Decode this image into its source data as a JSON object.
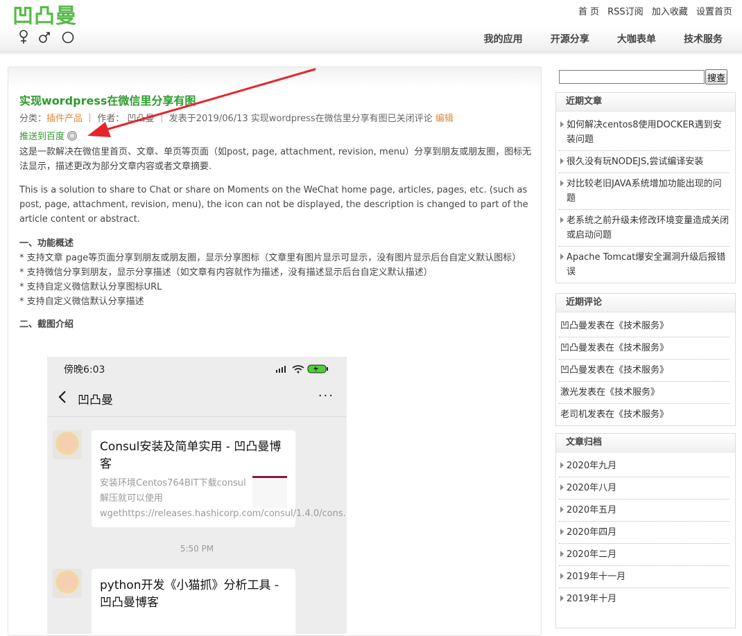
{
  "site": {
    "logo_text": "凹凸曼"
  },
  "top_links": [
    {
      "label": "首 页"
    },
    {
      "label": "RSS订阅"
    },
    {
      "label": "加入收藏"
    },
    {
      "label": "设置首页"
    }
  ],
  "nav": [
    {
      "label": "我的应用"
    },
    {
      "label": "开源分享"
    },
    {
      "label": "大咖表单"
    },
    {
      "label": "技术服务"
    }
  ],
  "post": {
    "title": "实现wordpress在微信里分享有图",
    "meta_category_label": "分类：",
    "meta_category": "插件产品",
    "meta_sep1": "｜ 作者：",
    "meta_author": "凹凸曼",
    "meta_sep2": "｜ 发表于2019/06/13 实现wordpress在微信里分享有图已关闭评论",
    "meta_edit": "编辑",
    "baidu_push": "推送到百度",
    "intro_cn": "这是一款解决在微信里首页、文章、单页等页面（如post, page, attachment, revision, menu）分享到朋友或朋友圈，图标无法显示，描述更改为部分文章内容或者文章摘要.",
    "intro_en": "This is a solution to share to Chat or share on Moments on the WeChat home page, articles, pages, etc. (such as post, page, attachment, revision, menu), the icon can not be displayed, the description is changed to part of the article content or abstract.",
    "section1_title": "一、功能概述",
    "features": [
      "*  支持文章 page等页面分享到朋友或朋友圈，显示分享图标（文章里有图片显示可显示，没有图片显示后台自定义默认图标）",
      "* 支持微信分享到朋友，显示分享描述（如文章有内容就作为描述，没有描述显示后台自定义默认描述）",
      "*  支持自定义微信默认分享图标URL",
      "*  支持自定义微信默认分享描述"
    ],
    "section2_title": "二、截图介绍"
  },
  "phone": {
    "status_time": "傍晚6:03",
    "chat_title": "凹凸曼",
    "more": "···",
    "card1_title": "Consul安装及简单实用 - 凹凸曼博客",
    "card1_desc": "安装环境Centos764BIT下载consul解压就可以使用wgethttps://releases.hashicorp.com/consul/1.4.0/cons...",
    "time_label": "5:50 PM",
    "card2_title": "python开发《小猫抓》分析工具 - 凹凸曼博客"
  },
  "sidebar": {
    "search_placeholder": "",
    "search_button": "搜查",
    "recent_posts_title": "近期文章",
    "recent_posts": [
      "如何解决centos8使用DOCKER遇到安装问题",
      "很久没有玩NODEJS,尝试编译安装",
      "对比较老旧JAVA系统增加功能出现的问题",
      "老系统之前升级未修改环境变量造成关闭或启动问题",
      "Apache Tomcat爆安全漏洞升级后报错误"
    ],
    "recent_comments_title": "近期评论",
    "recent_comments": [
      "凹凸曼发表在《技术服务》",
      "凹凸曼发表在《技术服务》",
      "凹凸曼发表在《技术服务》",
      "激光发表在《技术服务》",
      "老司机发表在《技术服务》"
    ],
    "archives_title": "文章归档",
    "archives": [
      "2020年九月",
      "2020年八月",
      "2020年五月",
      "2020年四月",
      "2020年二月",
      "2019年十一月",
      "2019年十月"
    ]
  },
  "colors": {
    "brand_green": "#57b947",
    "title_green": "#2b9b2b",
    "link_orange": "#e0883d",
    "annotation_red": "#e8242b"
  }
}
